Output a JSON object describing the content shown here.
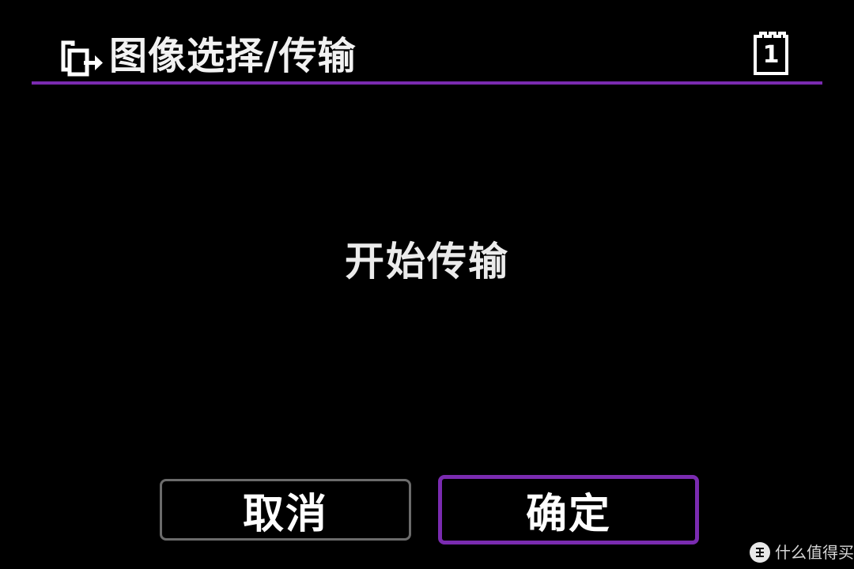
{
  "header": {
    "icon": "image-transfer-icon",
    "title": "图像选择/传输",
    "card_icon": "memory-card-icon",
    "card_number": "1"
  },
  "message": "开始传输",
  "buttons": {
    "cancel_label": "取消",
    "ok_label": "确定"
  },
  "watermark": {
    "badge_glyph": "值",
    "text": "什么值得买"
  },
  "colors": {
    "background": "#000000",
    "accent": "#7a2bb0",
    "text": "#ffffff",
    "cancel_border": "#6b6b6b"
  }
}
